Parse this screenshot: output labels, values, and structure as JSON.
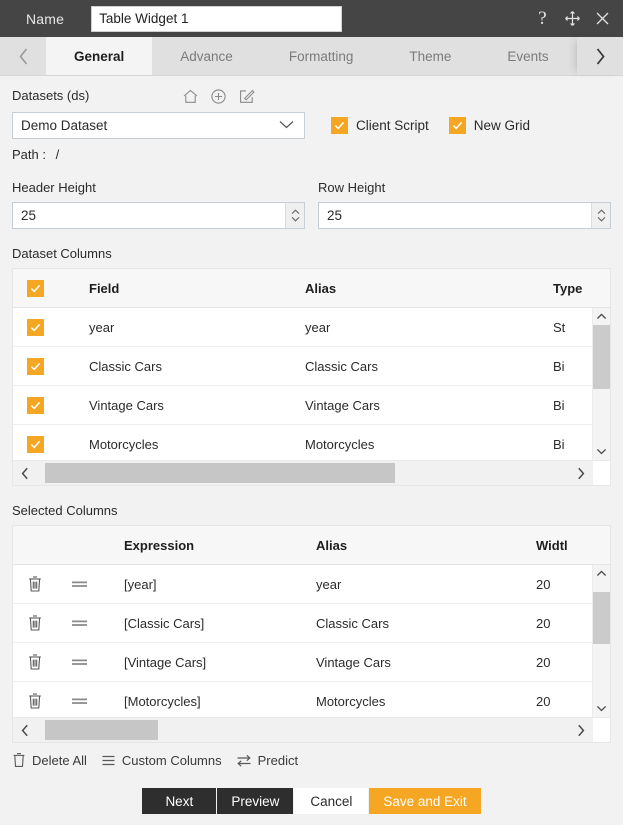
{
  "titlebar": {
    "name_label": "Name",
    "widget_name": "Table Widget 1",
    "name_placeholder": "",
    "help_icon": "help-icon",
    "move_icon": "move-icon",
    "close_icon": "close-icon"
  },
  "tabs": {
    "prev_icon": "chevron-left-icon",
    "next_icon": "chevron-right-icon",
    "items": [
      {
        "label": "General",
        "active": true
      },
      {
        "label": "Advance",
        "active": false
      },
      {
        "label": "Formatting",
        "active": false
      },
      {
        "label": "Theme",
        "active": false
      },
      {
        "label": "Events",
        "active": false
      }
    ]
  },
  "datasets": {
    "label": "Datasets (ds)",
    "home_icon": "home-icon",
    "add_icon": "plus-circle-icon",
    "edit_icon": "edit-icon",
    "selected": "Demo Dataset",
    "dropdown_icon": "chevron-down-icon",
    "checkboxes": [
      {
        "label": "Client Script",
        "checked": true
      },
      {
        "label": "New Grid",
        "checked": true
      }
    ],
    "path_label": "Path :",
    "path_value": "/"
  },
  "heights": {
    "header": {
      "label": "Header Height",
      "value": "25"
    },
    "row": {
      "label": "Row Height",
      "value": "25"
    }
  },
  "dataset_columns": {
    "title": "Dataset Columns",
    "header_checked": true,
    "headers": [
      "Field",
      "Alias",
      "Type"
    ],
    "rows": [
      {
        "checked": true,
        "field": "year",
        "alias": "year",
        "type": "St"
      },
      {
        "checked": true,
        "field": "Classic Cars",
        "alias": "Classic Cars",
        "type": "Bi"
      },
      {
        "checked": true,
        "field": "Vintage Cars",
        "alias": "Vintage Cars",
        "type": "Bi"
      },
      {
        "checked": true,
        "field": "Motorcycles",
        "alias": "Motorcycles",
        "type": "Bi"
      }
    ]
  },
  "selected_columns": {
    "title": "Selected Columns",
    "headers": [
      "Expression",
      "Alias",
      "Widtl"
    ],
    "rows": [
      {
        "delete_icon": "trash-icon",
        "drag_icon": "drag-handle-icon",
        "expression": "[year]",
        "alias": "year",
        "width": "20"
      },
      {
        "delete_icon": "trash-icon",
        "drag_icon": "drag-handle-icon",
        "expression": "[Classic Cars]",
        "alias": "Classic Cars",
        "width": "20"
      },
      {
        "delete_icon": "trash-icon",
        "drag_icon": "drag-handle-icon",
        "expression": "[Vintage Cars]",
        "alias": "Vintage Cars",
        "width": "20"
      },
      {
        "delete_icon": "trash-icon",
        "drag_icon": "drag-handle-icon",
        "expression": "[Motorcycles]",
        "alias": "Motorcycles",
        "width": "20"
      }
    ]
  },
  "tools": [
    {
      "label": "Delete All",
      "icon": "trash-icon"
    },
    {
      "label": "Custom Columns",
      "icon": "list-icon"
    },
    {
      "label": "Predict",
      "icon": "swap-icon"
    }
  ],
  "footer": {
    "next": "Next",
    "preview": "Preview",
    "cancel": "Cancel",
    "save_and_exit": "Save and Exit"
  },
  "colors": {
    "accent": "#f5a623",
    "titlebar": "#454545",
    "dark_button": "#2e2e2e",
    "page_bg": "#f2f2f2"
  }
}
